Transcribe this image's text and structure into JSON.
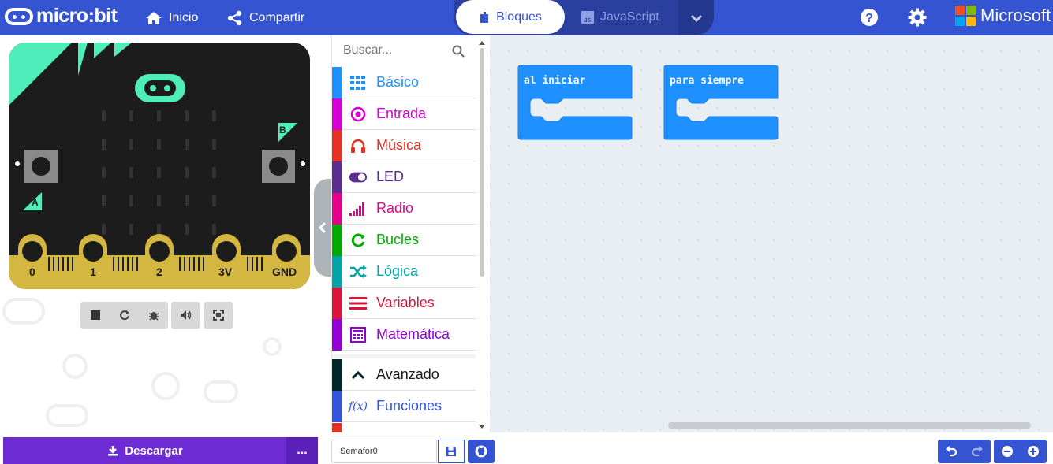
{
  "header": {
    "brand": "micro:bit",
    "home_label": "Inicio",
    "share_label": "Compartir",
    "tab_blocks": "Bloques",
    "tab_javascript": "JavaScript",
    "microsoft": "Microsoft",
    "icons": [
      "home-icon",
      "share-icon",
      "puzzle-icon",
      "js-icon",
      "chevron-down-icon",
      "help-icon",
      "gear-icon",
      "microsoft-logo"
    ]
  },
  "simulator": {
    "button_a": "A",
    "button_b": "B",
    "pins": [
      "0",
      "1",
      "2",
      "3V",
      "GND"
    ],
    "controls": [
      "stop-icon",
      "restart-icon",
      "debug-icon",
      "sound-icon",
      "fullscreen-icon"
    ]
  },
  "toolbox": {
    "search_placeholder": "Buscar...",
    "categories": [
      {
        "label": "Básico",
        "color": "#1e90ff",
        "icon": "grid-icon"
      },
      {
        "label": "Entrada",
        "color": "#d400d4",
        "icon": "target-icon"
      },
      {
        "label": "Música",
        "color": "#e63022",
        "icon": "headphones-icon"
      },
      {
        "label": "LED",
        "color": "#5c2d91",
        "icon": "toggle-icon"
      },
      {
        "label": "Radio",
        "color": "#e3008c",
        "icon": "signal-icon"
      },
      {
        "label": "Bucles",
        "color": "#00aa00",
        "icon": "loop-icon"
      },
      {
        "label": "Lógica",
        "color": "#00a4a6",
        "icon": "shuffle-icon"
      },
      {
        "label": "Variables",
        "color": "#dc143c",
        "icon": "lines-icon"
      },
      {
        "label": "Matemática",
        "color": "#9400d3",
        "icon": "calculator-icon"
      }
    ],
    "advanced": {
      "label": "Avanzado",
      "color": "#00272b"
    },
    "functions": {
      "label": "Funciones",
      "color": "#3455db"
    }
  },
  "workspace": {
    "blocks": [
      {
        "label": "al iniciar",
        "color": "#1e90ff"
      },
      {
        "label": "para siempre",
        "color": "#1e90ff"
      }
    ]
  },
  "footer": {
    "download_label": "Descargar",
    "more_label": "...",
    "project_name": "Semafor0"
  },
  "colors": {
    "header": "#3454d1",
    "download": "#6c2bd3",
    "board_accent": "#4eedb9",
    "pins": "#d4b740"
  }
}
